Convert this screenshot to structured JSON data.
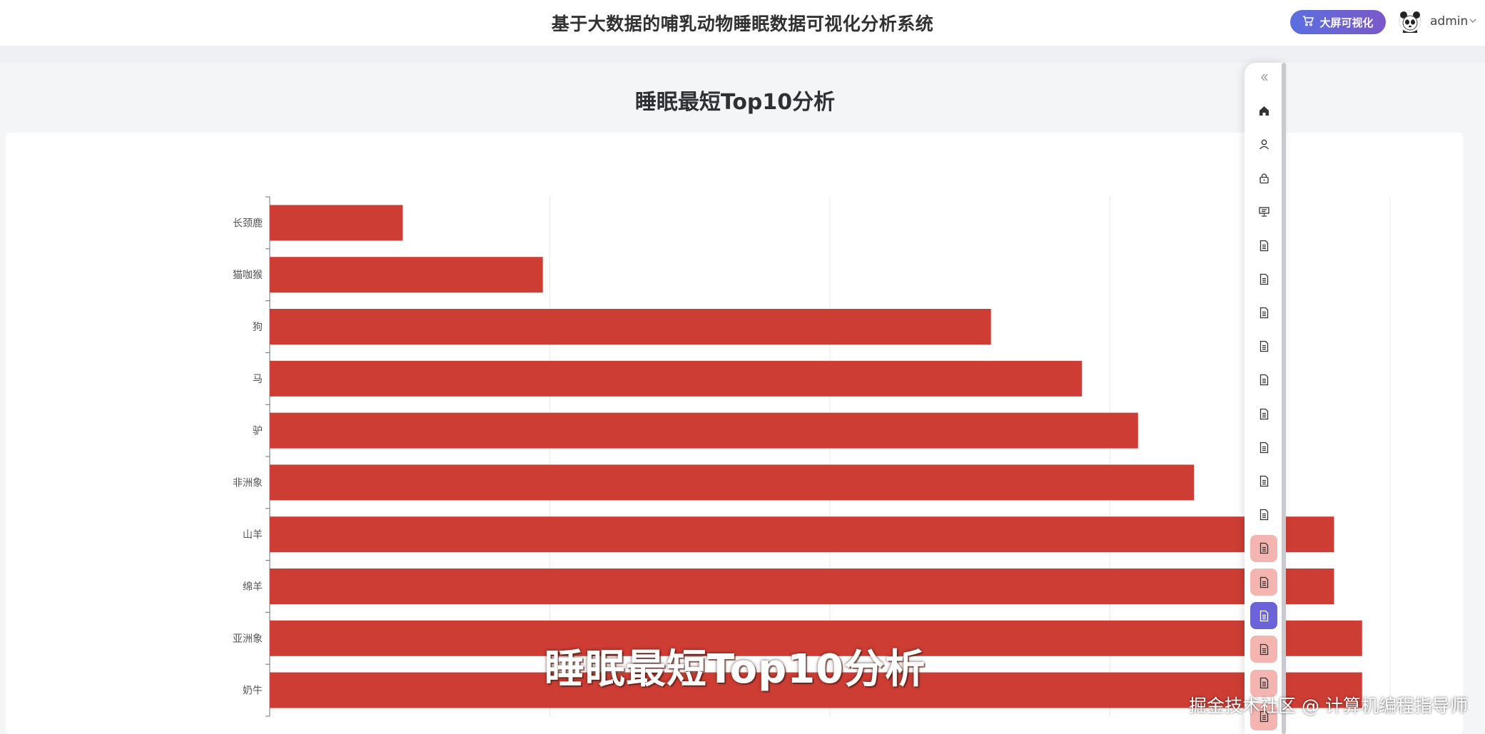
{
  "header": {
    "title": "基于大数据的哺乳动物睡眠数据可视化分析系统",
    "screen_button_label": "大屏可视化",
    "username": "admin"
  },
  "page": {
    "title": "睡眠最短Top10分析"
  },
  "colors": {
    "bar": "#cd3d34",
    "accent": "#6d63d8",
    "grid": "#e8eaed"
  },
  "chart_data": {
    "type": "bar",
    "orientation": "horizontal",
    "categories": [
      "长颈鹿",
      "猫咖猴",
      "狗",
      "马",
      "驴",
      "非洲象",
      "山羊",
      "绵羊",
      "亚洲象",
      "奶牛"
    ],
    "values": [
      1.9,
      3.9,
      10.3,
      11.6,
      12.4,
      13.2,
      15.2,
      15.2,
      15.6,
      15.6
    ],
    "xlim": [
      0,
      16
    ],
    "grid": true,
    "title": "",
    "xlabel": "",
    "ylabel": ""
  },
  "side_nav": {
    "items": [
      {
        "icon": "collapse-icon"
      },
      {
        "icon": "home-icon"
      },
      {
        "icon": "user-icon"
      },
      {
        "icon": "lock-icon"
      },
      {
        "icon": "screen-icon"
      },
      {
        "icon": "document-icon"
      },
      {
        "icon": "document-icon"
      },
      {
        "icon": "document-icon"
      },
      {
        "icon": "document-icon"
      },
      {
        "icon": "document-icon"
      },
      {
        "icon": "document-icon"
      },
      {
        "icon": "document-icon"
      },
      {
        "icon": "document-icon"
      },
      {
        "icon": "document-icon"
      },
      {
        "icon": "document-icon"
      },
      {
        "icon": "document-icon"
      },
      {
        "icon": "document-icon",
        "active": true
      },
      {
        "icon": "document-icon"
      },
      {
        "icon": "document-icon"
      },
      {
        "icon": "document-icon"
      }
    ]
  },
  "overlay": {
    "caption": "睡眠最短Top10分析",
    "watermark": "掘金技术社区 @ 计算机编程指导师"
  }
}
